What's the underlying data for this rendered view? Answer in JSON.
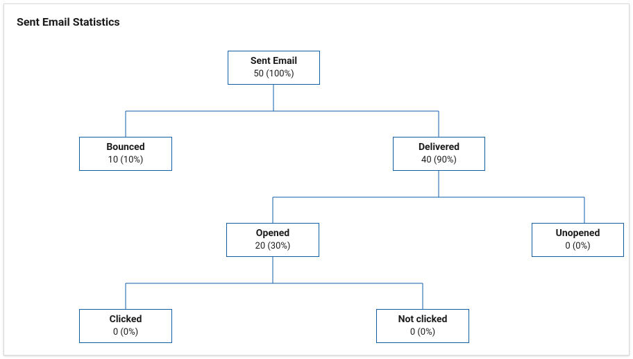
{
  "title": "Sent Email Statistics",
  "nodes": {
    "sent": {
      "label": "Sent Email",
      "value": "50 (100%)"
    },
    "bounced": {
      "label": "Bounced",
      "value": "10 (10%)"
    },
    "delivered": {
      "label": "Delivered",
      "value": "40 (90%)"
    },
    "opened": {
      "label": "Opened",
      "value": "20 (30%)"
    },
    "unopened": {
      "label": "Unopened",
      "value": "0 (0%)"
    },
    "clicked": {
      "label": "Clicked",
      "value": "0 (0%)"
    },
    "notclicked": {
      "label": "Not clicked",
      "value": "0 (0%)"
    }
  },
  "chart_data": {
    "type": "tree",
    "title": "Sent Email Statistics",
    "nodes": [
      {
        "id": "sent",
        "label": "Sent Email",
        "count": 50,
        "percent": 100
      },
      {
        "id": "bounced",
        "label": "Bounced",
        "count": 10,
        "percent": 10
      },
      {
        "id": "delivered",
        "label": "Delivered",
        "count": 40,
        "percent": 90
      },
      {
        "id": "opened",
        "label": "Opened",
        "count": 20,
        "percent": 30
      },
      {
        "id": "unopened",
        "label": "Unopened",
        "count": 0,
        "percent": 0
      },
      {
        "id": "clicked",
        "label": "Clicked",
        "count": 0,
        "percent": 0
      },
      {
        "id": "notclicked",
        "label": "Not clicked",
        "count": 0,
        "percent": 0
      }
    ],
    "edges": [
      {
        "from": "sent",
        "to": "bounced"
      },
      {
        "from": "sent",
        "to": "delivered"
      },
      {
        "from": "delivered",
        "to": "opened"
      },
      {
        "from": "delivered",
        "to": "unopened"
      },
      {
        "from": "opened",
        "to": "clicked"
      },
      {
        "from": "opened",
        "to": "notclicked"
      }
    ]
  }
}
